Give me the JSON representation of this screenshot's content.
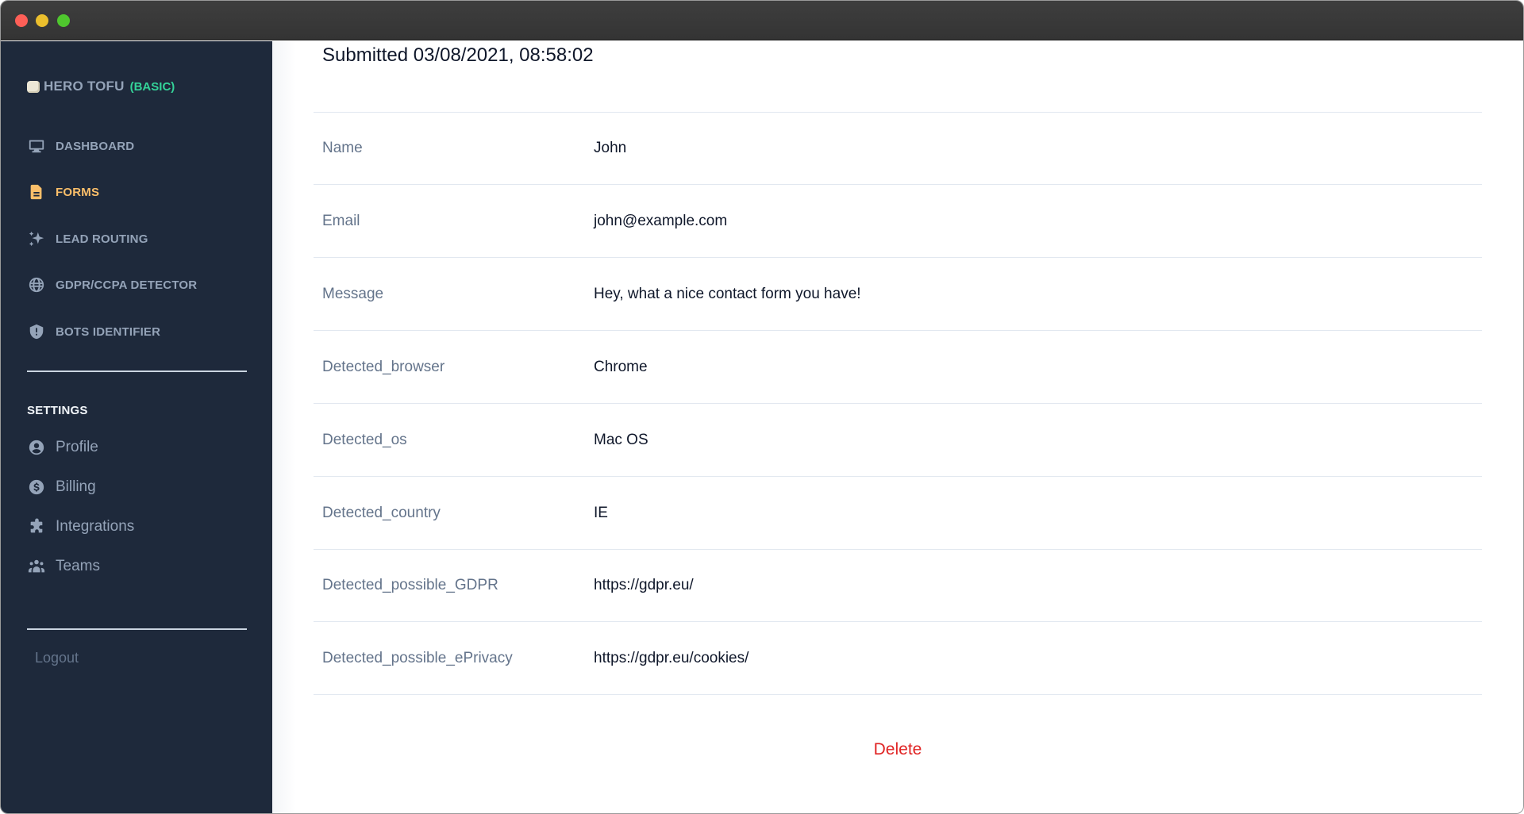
{
  "window": {
    "controls": [
      "close",
      "minimize",
      "zoom"
    ]
  },
  "sidebar": {
    "brand": {
      "name": "HERO TOFU",
      "plan": "(BASIC)",
      "icon": "tofu-icon"
    },
    "nav": [
      {
        "label": "DASHBOARD",
        "icon": "monitor-icon",
        "active": false
      },
      {
        "label": "FORMS",
        "icon": "document-icon",
        "active": true
      },
      {
        "label": "LEAD ROUTING",
        "icon": "sparkles-icon",
        "active": false
      },
      {
        "label": "GDPR/CCPA DETECTOR",
        "icon": "globe-icon",
        "active": false
      },
      {
        "label": "BOTS IDENTIFIER",
        "icon": "shield-exclamation-icon",
        "active": false
      }
    ],
    "settings_heading": "SETTINGS",
    "settings": [
      {
        "label": "Profile",
        "icon": "user-circle-icon"
      },
      {
        "label": "Billing",
        "icon": "dollar-circle-icon"
      },
      {
        "label": "Integrations",
        "icon": "puzzle-icon"
      },
      {
        "label": "Teams",
        "icon": "user-group-icon"
      }
    ],
    "logout_label": "Logout"
  },
  "colors": {
    "sidebar_bg": "#1e293b",
    "active": "#fbbf6a",
    "plan_badge": "#34d399",
    "danger": "#e02424"
  },
  "submission": {
    "title": "Submitted 03/08/2021, 08:58:02",
    "fields": [
      {
        "label": "Name",
        "value": "John"
      },
      {
        "label": "Email",
        "value": "john@example.com"
      },
      {
        "label": "Message",
        "value": "Hey, what a nice contact form you have!"
      },
      {
        "label": "Detected_browser",
        "value": "Chrome"
      },
      {
        "label": "Detected_os",
        "value": "Mac OS"
      },
      {
        "label": "Detected_country",
        "value": "IE"
      },
      {
        "label": "Detected_possible_GDPR",
        "value": "https://gdpr.eu/"
      },
      {
        "label": "Detected_possible_ePrivacy",
        "value": "https://gdpr.eu/cookies/"
      }
    ],
    "delete_label": "Delete"
  }
}
